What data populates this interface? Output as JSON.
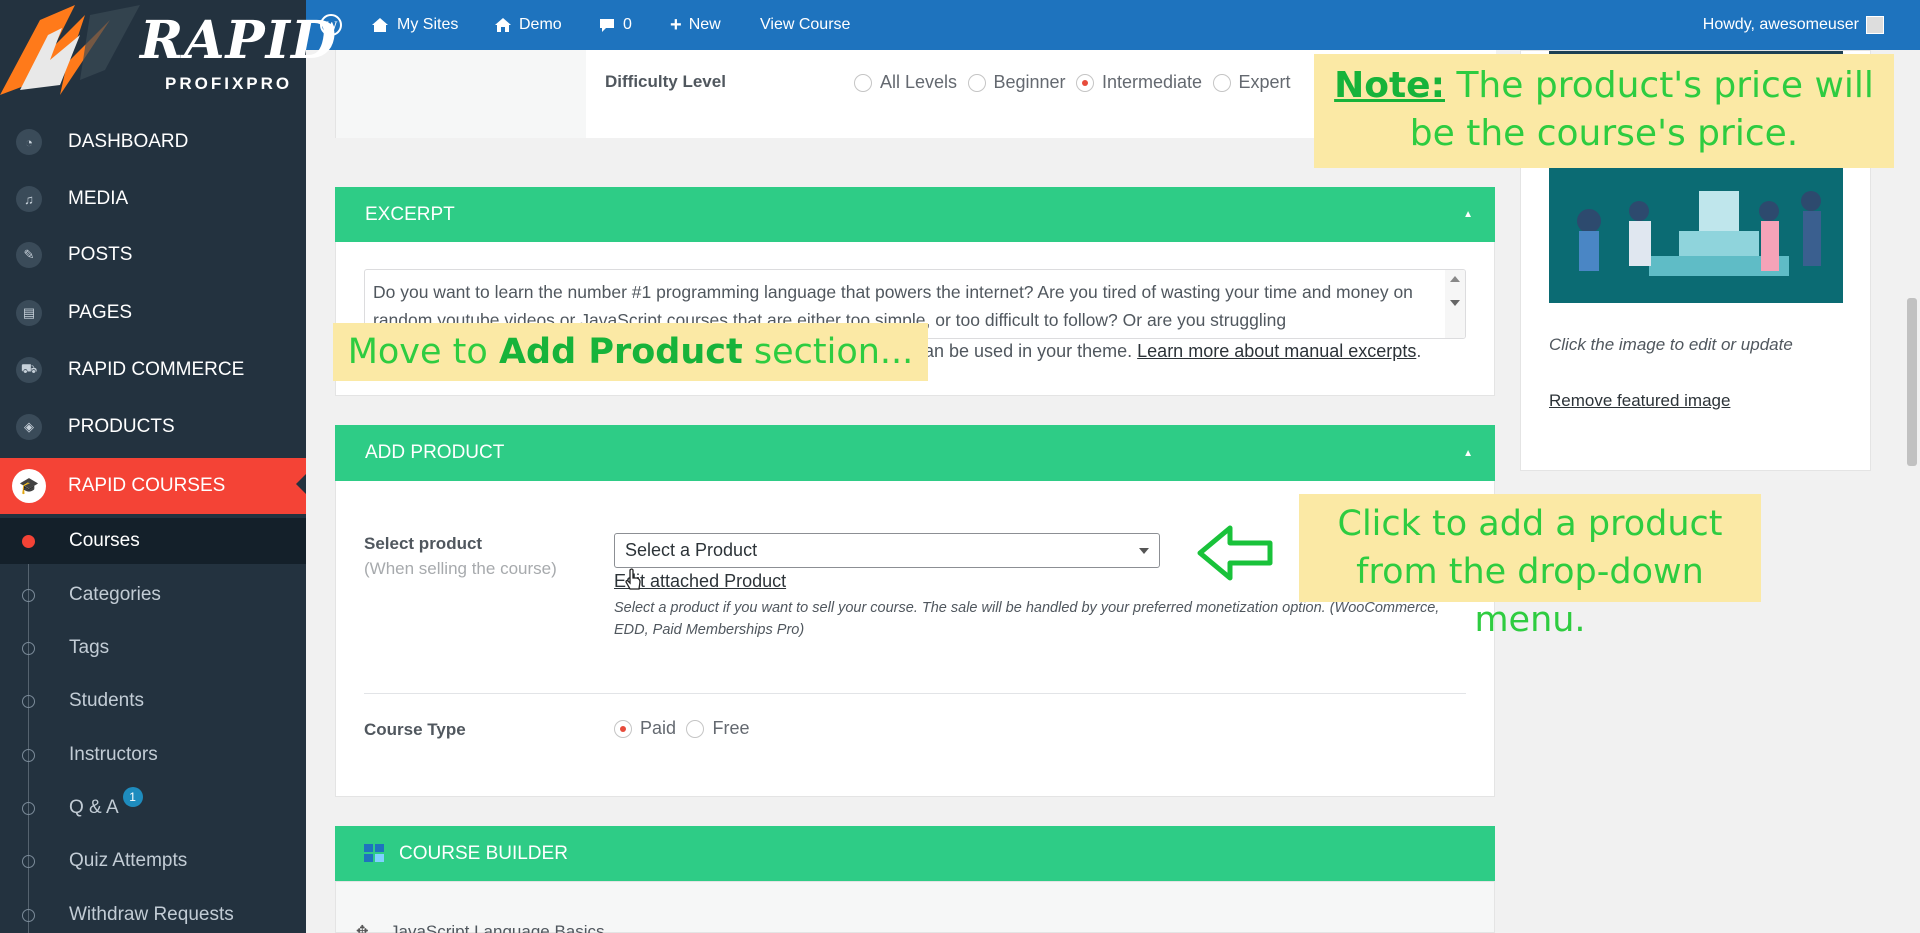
{
  "brand": {
    "name": "RAPID",
    "tagline": "PROFIXPRO"
  },
  "sidebar": {
    "items": [
      {
        "label": "DASHBOARD",
        "icon": "dashboard-icon"
      },
      {
        "label": "MEDIA",
        "icon": "media-icon"
      },
      {
        "label": "POSTS",
        "icon": "pin-icon"
      },
      {
        "label": "PAGES",
        "icon": "pages-icon"
      },
      {
        "label": "RAPID COMMERCE",
        "icon": "cart-icon"
      },
      {
        "label": "PRODUCTS",
        "icon": "box-icon"
      },
      {
        "label": "RAPID COURSES",
        "icon": "graduation-cap-icon"
      }
    ],
    "subitems": [
      {
        "label": "Courses"
      },
      {
        "label": "Categories"
      },
      {
        "label": "Tags"
      },
      {
        "label": "Students"
      },
      {
        "label": "Instructors"
      },
      {
        "label": "Q & A",
        "badge": "1"
      },
      {
        "label": "Quiz Attempts"
      },
      {
        "label": "Withdraw Requests"
      }
    ]
  },
  "adminbar": {
    "my_sites": "My Sites",
    "site": "Demo",
    "comments": "0",
    "new": "New",
    "view_course": "View Course",
    "howdy": "Howdy, awesomeuser"
  },
  "difficulty": {
    "label": "Difficulty Level",
    "options": [
      "All Levels",
      "Beginner",
      "Intermediate",
      "Expert"
    ],
    "selected": "Intermediate"
  },
  "excerpt": {
    "title": "EXCERPT",
    "text": "Do you want to learn the number #1 programming language that powers the internet? Are you tired of wasting your time and money on random youtube videos or JavaScript courses that are either too simple, or too difficult to follow? Or are you struggling",
    "help_prefix": "an be used in your theme.",
    "help_link": "Learn more about manual excerpts"
  },
  "add_product": {
    "title": "ADD PRODUCT",
    "select_label": "Select product",
    "select_sub": "(When selling the course)",
    "select_value": "Select a Product",
    "edit_link": "Edit attached Product",
    "help_line1": "Select a product if you want to sell your course. The sale will be handled by your preferred monetization option. (WooCommerce,",
    "help_line2": "EDD, Paid Memberships Pro)",
    "course_type_label": "Course Type",
    "course_type_options": [
      "Paid",
      "Free"
    ],
    "course_type_selected": "Paid"
  },
  "course_builder": {
    "title": "COURSE BUILDER",
    "first_topic": "JavaScript Language Basics"
  },
  "featured_image": {
    "caption": "Click the image to edit or update",
    "remove_link": "Remove featured image"
  },
  "notes": {
    "price_note_label": "Note:",
    "price_note_text": " The product's price will be the course's price.",
    "move_prefix": "Move to ",
    "move_bold": "Add Product",
    "move_suffix": " section...",
    "click_note": "Click to add a product from the drop-down menu."
  },
  "colors": {
    "green": "#2ecc86",
    "accent_red": "#f44336",
    "admin_blue": "#1e73be",
    "sidebar": "#23323f"
  }
}
